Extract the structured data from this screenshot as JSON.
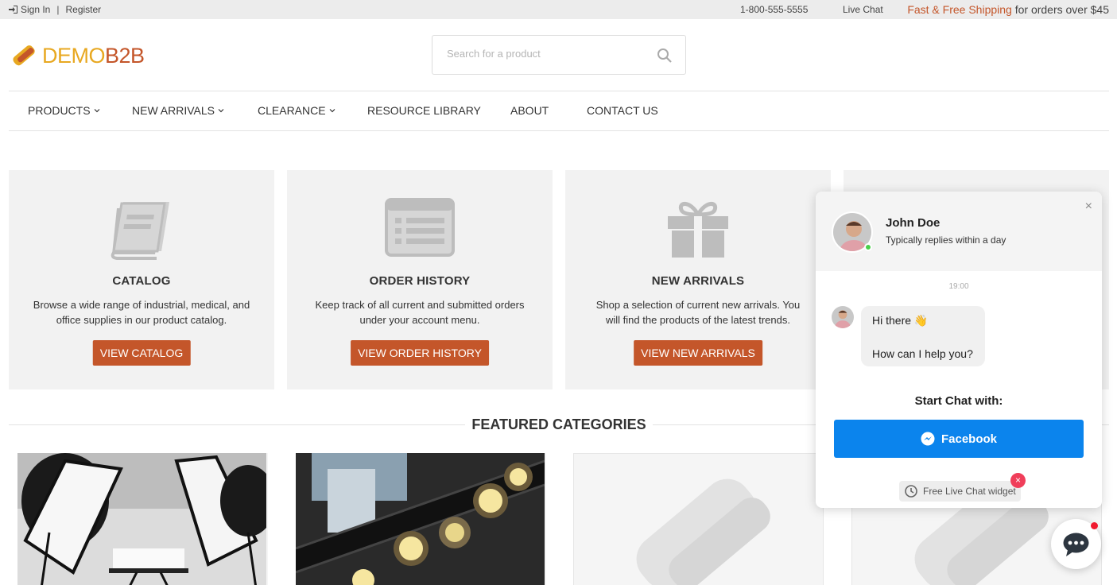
{
  "topbar": {
    "signin": "Sign In",
    "separator": "|",
    "register": "Register",
    "phone": "1-800-555-5555",
    "live_chat": "Live Chat",
    "shipping_accent": "Fast & Free Shipping",
    "shipping_rest": " for orders over $45"
  },
  "logo": {
    "part1": "DEMO",
    "part2": "B2B"
  },
  "search": {
    "placeholder": "Search for a product"
  },
  "nav": {
    "products": "PRODUCTS",
    "new_arrivals": "NEW ARRIVALS",
    "clearance": "CLEARANCE",
    "resource_library": "RESOURCE LIBRARY",
    "about": "ABOUT",
    "contact_us": "CONTACT US"
  },
  "cards": [
    {
      "title": "CATALOG",
      "text": "Browse a wide range of industrial, medical, and office supplies in our product catalog.",
      "button": "VIEW CATALOG",
      "icon": "book-icon"
    },
    {
      "title": "ORDER HISTORY",
      "text": "Keep track of all current and submitted orders under your account menu.",
      "button": "VIEW ORDER HISTORY",
      "icon": "list-icon"
    },
    {
      "title": "NEW ARRIVALS",
      "text": "Shop a selection of current new arrivals. You will find the products of the latest trends.",
      "button": "VIEW NEW ARRIVALS",
      "icon": "gift-icon"
    }
  ],
  "featured": {
    "title": "FEATURED CATEGORIES"
  },
  "chat": {
    "close": "×",
    "agent_name": "John Doe",
    "agent_status": "Typically replies within a day",
    "time": "19:00",
    "greeting": "Hi there 👋",
    "question": "How can I help you?",
    "start_label": "Start Chat with:",
    "facebook": "Facebook",
    "widget_badge": "Free Live Chat widget",
    "badge_close": "×"
  },
  "colors": {
    "accent": "#c4562a",
    "logo_yellow": "#e8a821",
    "facebook_blue": "#0b84ed",
    "card_bg": "#f2f2f2"
  }
}
